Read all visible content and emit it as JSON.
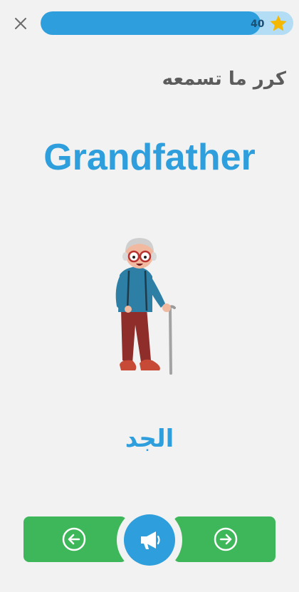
{
  "header": {
    "close_icon": "close-icon",
    "progress": {
      "fraction": 0.87,
      "score": "40",
      "star_icon": "star-icon"
    }
  },
  "lesson": {
    "instruction": "كرر ما تسمعه",
    "word_en": "Grandfather",
    "word_ar": "الجد",
    "illustration": "grandfather-illustration"
  },
  "controls": {
    "prev_icon": "arrow-left-icon",
    "next_icon": "arrow-right-icon",
    "audio_icon": "megaphone-icon"
  },
  "colors": {
    "accent": "#2e9fdc",
    "progress_track": "#b3dcf5",
    "green": "#3eb75a",
    "star": "#f5b800",
    "background": "#f2f2f2"
  }
}
